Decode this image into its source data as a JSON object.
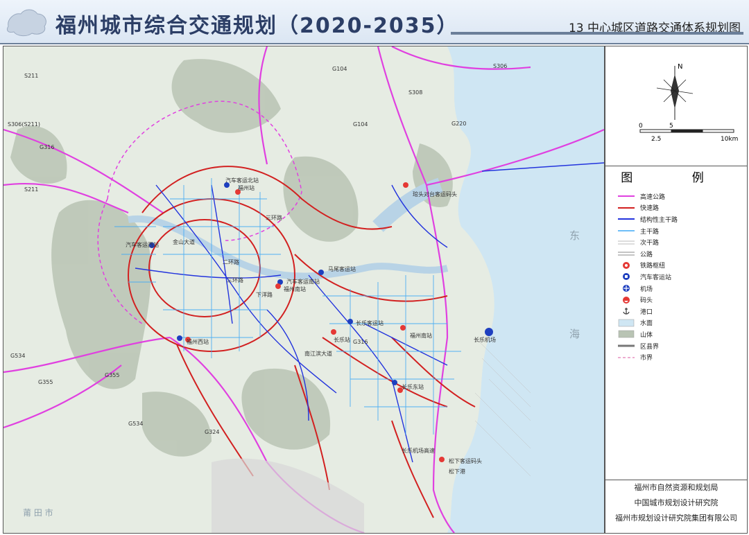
{
  "header": {
    "title": "福州城市综合交通规划（2020-2035）",
    "subtitle": "13 中心城区道路交通体系规划图"
  },
  "compass": {
    "north_label": "N"
  },
  "scale": {
    "labels": [
      "0",
      "5",
      "2.5",
      "10km"
    ]
  },
  "legend": {
    "title": "图  例",
    "items": [
      {
        "label": "高速公路",
        "color": "#e040e0",
        "icon": "magenta-line"
      },
      {
        "label": "快速路",
        "color": "#d22020",
        "icon": "red-line"
      },
      {
        "label": "结构性主干路",
        "color": "#2233dd",
        "icon": "blue-line"
      },
      {
        "label": "主干路",
        "color": "#3fa9f5",
        "icon": "light-blue-line"
      },
      {
        "label": "次干路",
        "color": "#bbbbbb",
        "icon": "grey-double-line"
      },
      {
        "label": "公路",
        "color": "#888888",
        "icon": "dark-double-line"
      },
      {
        "label": "铁路枢纽",
        "color": "#e53935",
        "icon": "rail-hub-icon"
      },
      {
        "label": "汽车客运站",
        "color": "#1e3fbf",
        "icon": "bus-station-icon"
      },
      {
        "label": "机场",
        "color": "#1e3fbf",
        "icon": "airport-icon"
      },
      {
        "label": "码头",
        "color": "#e53935",
        "icon": "wharf-icon"
      },
      {
        "label": "港口",
        "color": "#333333",
        "icon": "anchor-icon"
      },
      {
        "label": "水面",
        "color": "#cfe6f3",
        "icon": "water-swatch"
      },
      {
        "label": "山体",
        "color": "#b9c4b4",
        "icon": "mountain-swatch"
      },
      {
        "label": "区县界",
        "color": "#777777",
        "icon": "district-boundary-line"
      },
      {
        "label": "市界",
        "color": "#e890c0",
        "icon": "city-boundary-line"
      }
    ]
  },
  "map": {
    "region_labels": {
      "sea_dong": "东",
      "sea_hai": "海",
      "putian": "莆  田  市"
    },
    "road_labels": [
      "S211",
      "S306(S211)",
      "G316",
      "G104",
      "S306",
      "S308",
      "G220",
      "S211",
      "G534",
      "G355",
      "G355",
      "G534",
      "G324",
      "G104",
      "G316"
    ],
    "places": [
      "汽车客运北站",
      "福州站",
      "汽车客运西站",
      "汽车客运南站",
      "福州南站",
      "马尾客运站",
      "长乐客运站",
      "福州南站",
      "长乐站",
      "长乐东站",
      "长乐机场",
      "福州西站",
      "琯头对台客运码头",
      "松下客运码头",
      "松下港",
      "三环路",
      "二环路",
      "三环路",
      "金山大道",
      "下洋路",
      "南江滨大道",
      "长乐机场高速"
    ]
  },
  "credits": [
    "福州市自然资源和规划局",
    "中国城市规划设计研究院",
    "福州市规划设计研究院集团有限公司"
  ]
}
